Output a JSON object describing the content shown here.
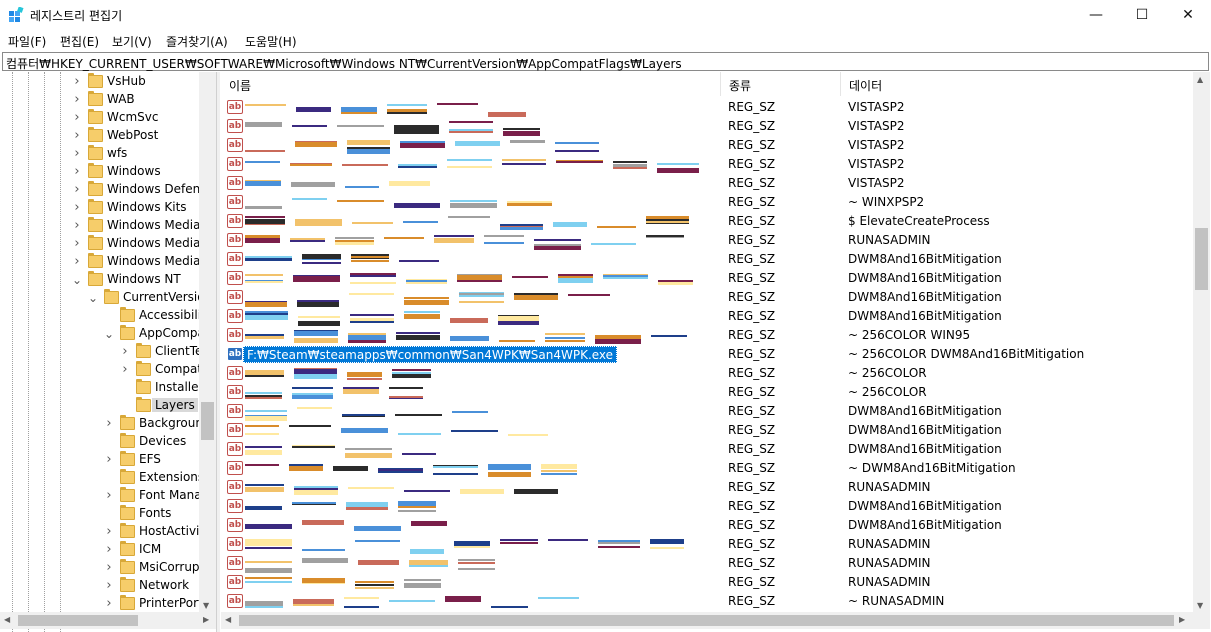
{
  "window": {
    "title": "레지스트리 편집기",
    "minimize": "—",
    "maximize": "☐",
    "close": "✕",
    "icon": "regedit-icon"
  },
  "menu": [
    "파일(F)",
    "편집(E)",
    "보기(V)",
    "즐겨찾기(A)",
    "도움말(H)"
  ],
  "address": "컴퓨터₩HKEY_CURRENT_USER₩SOFTWARE₩Microsoft₩Windows NT₩CurrentVersion₩AppCompatFlags₩Layers",
  "tree": [
    {
      "label": "VsHub",
      "level": 3,
      "expander": true
    },
    {
      "label": "WAB",
      "level": 3,
      "expander": true
    },
    {
      "label": "WcmSvc",
      "level": 3,
      "expander": true
    },
    {
      "label": "WebPost",
      "level": 3,
      "expander": true
    },
    {
      "label": "wfs",
      "level": 3,
      "expander": true
    },
    {
      "label": "Windows",
      "level": 3,
      "expander": true
    },
    {
      "label": "Windows Defend",
      "level": 3,
      "expander": true
    },
    {
      "label": "Windows Kits",
      "level": 3,
      "expander": true
    },
    {
      "label": "Windows Media",
      "level": 3,
      "expander": true
    },
    {
      "label": "Windows Media",
      "level": 3,
      "expander": true
    },
    {
      "label": "Windows Media T",
      "level": 3,
      "expander": true
    },
    {
      "label": "Windows NT",
      "level": 3,
      "expander": true,
      "expanded": true
    },
    {
      "label": "CurrentVersion",
      "level": 4,
      "expander": true,
      "expanded": true
    },
    {
      "label": "Accessibility",
      "level": 5,
      "expander": false
    },
    {
      "label": "AppCompat",
      "level": 5,
      "expander": true,
      "expanded": true
    },
    {
      "label": "ClientTe",
      "level": 6,
      "expander": true
    },
    {
      "label": "Compat",
      "level": 6,
      "expander": true
    },
    {
      "label": "Installed",
      "level": 6,
      "expander": false
    },
    {
      "label": "Layers",
      "level": 6,
      "expander": false,
      "selected": true
    },
    {
      "label": "Background",
      "level": 5,
      "expander": true
    },
    {
      "label": "Devices",
      "level": 5,
      "expander": false
    },
    {
      "label": "EFS",
      "level": 5,
      "expander": true
    },
    {
      "label": "Extensions",
      "level": 5,
      "expander": false
    },
    {
      "label": "Font Manage",
      "level": 5,
      "expander": true
    },
    {
      "label": "Fonts",
      "level": 5,
      "expander": false
    },
    {
      "label": "HostActivity",
      "level": 5,
      "expander": true
    },
    {
      "label": "ICM",
      "level": 5,
      "expander": true
    },
    {
      "label": "MsiCorrupt",
      "level": 5,
      "expander": true
    },
    {
      "label": "Network",
      "level": 5,
      "expander": true
    },
    {
      "label": "PrinterPorts",
      "level": 5,
      "expander": true
    }
  ],
  "columns": {
    "name": "이름",
    "type": "종류",
    "data": "데이터"
  },
  "rows": [
    {
      "type": "REG_SZ",
      "data": "VISTASP2"
    },
    {
      "type": "REG_SZ",
      "data": "VISTASP2"
    },
    {
      "type": "REG_SZ",
      "data": "VISTASP2"
    },
    {
      "type": "REG_SZ",
      "data": "VISTASP2"
    },
    {
      "type": "REG_SZ",
      "data": "VISTASP2"
    },
    {
      "type": "REG_SZ",
      "data": "~ WINXPSP2"
    },
    {
      "type": "REG_SZ",
      "data": "$ ElevateCreateProcess"
    },
    {
      "type": "REG_SZ",
      "data": "RUNASADMIN"
    },
    {
      "type": "REG_SZ",
      "data": "DWM8And16BitMitigation"
    },
    {
      "type": "REG_SZ",
      "data": "DWM8And16BitMitigation"
    },
    {
      "type": "REG_SZ",
      "data": "DWM8And16BitMitigation"
    },
    {
      "type": "REG_SZ",
      "data": "DWM8And16BitMitigation"
    },
    {
      "type": "REG_SZ",
      "data": "~ 256COLOR WIN95"
    },
    {
      "type": "REG_SZ",
      "data": "~ 256COLOR DWM8And16BitMitigation",
      "name": "F:₩Steam₩steamapps₩common₩San4WPK₩San4WPK.exe",
      "selected": true
    },
    {
      "type": "REG_SZ",
      "data": "~ 256COLOR"
    },
    {
      "type": "REG_SZ",
      "data": "~ 256COLOR"
    },
    {
      "type": "REG_SZ",
      "data": "DWM8And16BitMitigation"
    },
    {
      "type": "REG_SZ",
      "data": "DWM8And16BitMitigation"
    },
    {
      "type": "REG_SZ",
      "data": "DWM8And16BitMitigation"
    },
    {
      "type": "REG_SZ",
      "data": "~ DWM8And16BitMitigation"
    },
    {
      "type": "REG_SZ",
      "data": "RUNASADMIN"
    },
    {
      "type": "REG_SZ",
      "data": "DWM8And16BitMitigation"
    },
    {
      "type": "REG_SZ",
      "data": "DWM8And16BitMitigation"
    },
    {
      "type": "REG_SZ",
      "data": "RUNASADMIN"
    },
    {
      "type": "REG_SZ",
      "data": "RUNASADMIN"
    },
    {
      "type": "REG_SZ",
      "data": "RUNASADMIN"
    },
    {
      "type": "REG_SZ",
      "data": "~ RUNASADMIN"
    }
  ],
  "value_icon_text": "ab",
  "colors": {
    "selection": "#0078d7",
    "folder": "#f6cd6a",
    "value_icon": "#c0504d"
  }
}
